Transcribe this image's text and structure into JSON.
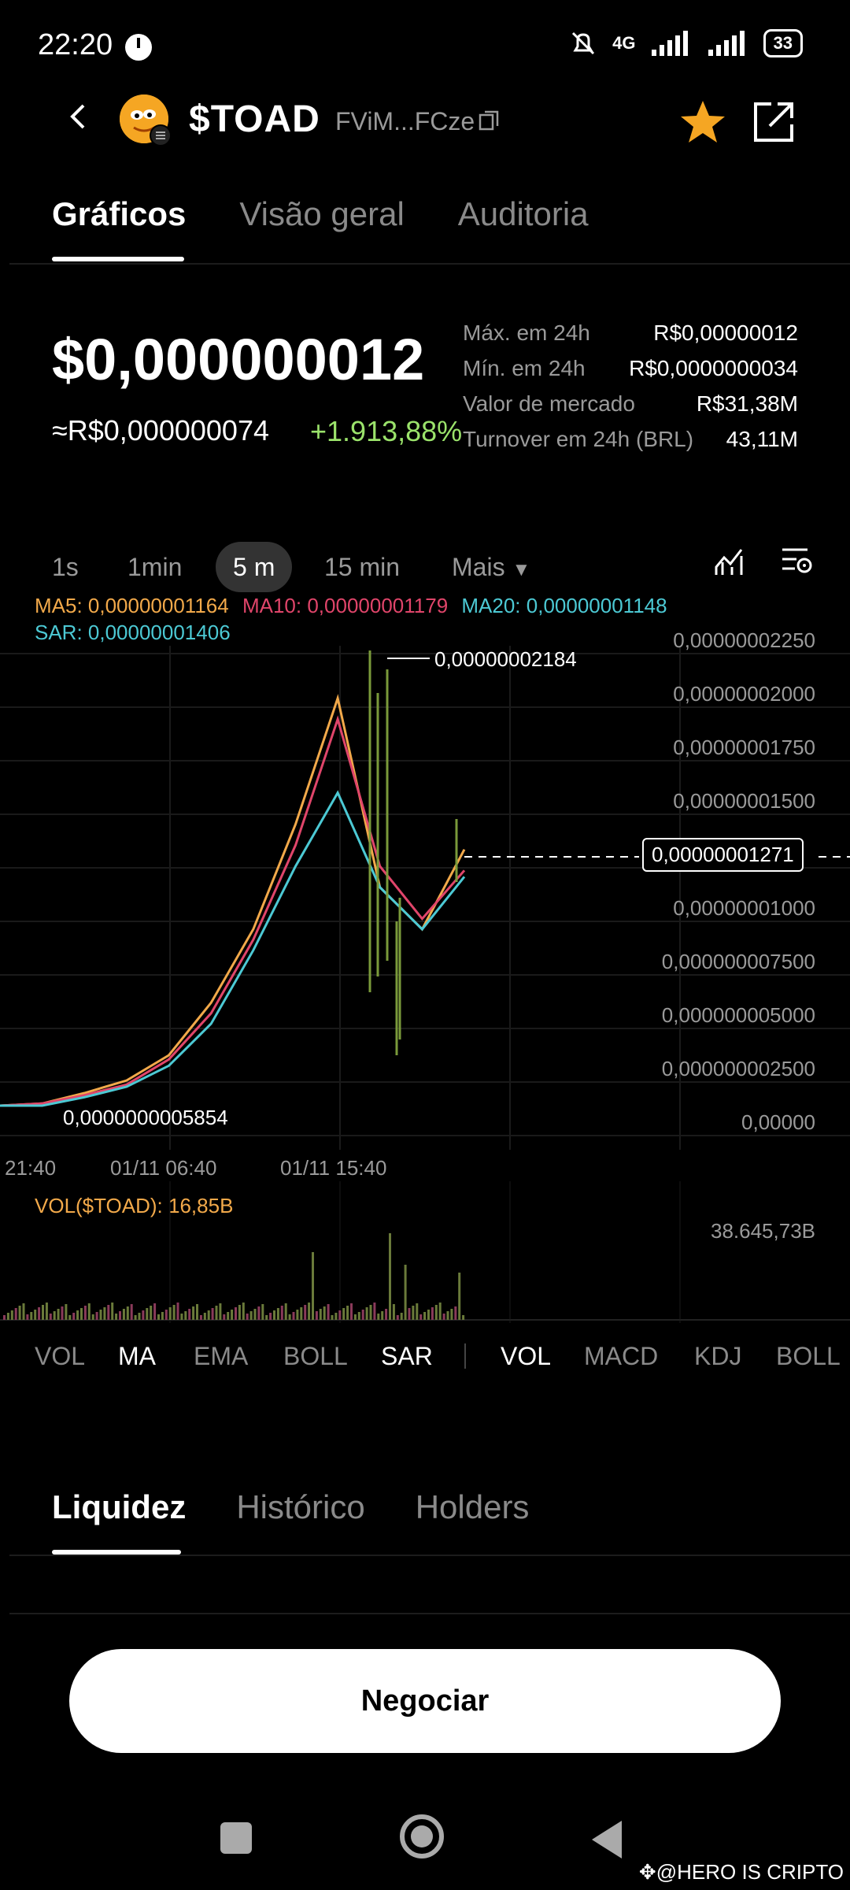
{
  "status": {
    "time": "22:20",
    "network": "4G",
    "battery": "33"
  },
  "header": {
    "token": "$TOAD",
    "address": "FViM...FCze"
  },
  "tabs": [
    "Gráficos",
    "Visão geral",
    "Auditoria"
  ],
  "price": {
    "usd": "$0,000000012",
    "brl": "≈R$0,000000074",
    "change": "+1.913,88%"
  },
  "stats": [
    {
      "label": "Máx. em 24h",
      "value": "R$0,00000012"
    },
    {
      "label": "Mín. em 24h",
      "value": "R$0,0000000034"
    },
    {
      "label": "Valor de mercado",
      "value": "R$31,38M"
    },
    {
      "label": "Turnover em 24h (BRL)",
      "value": "43,11M"
    }
  ],
  "timeframes": [
    "1s",
    "1min",
    "5 m",
    "15 min",
    "Mais"
  ],
  "indicators": {
    "ma5": "MA5: 0,00000001164",
    "ma10": "MA10: 0,00000001179",
    "ma20": "MA20: 0,00000001148",
    "sar": "SAR: 0,00000001406"
  },
  "chart": {
    "y_ticks": [
      "0,00000002250",
      "0,00000002000",
      "0,00000001750",
      "0,00000001500",
      "0,00000001000",
      "0,000000007500",
      "0,000000005000",
      "0,000000002500",
      "0,00000"
    ],
    "current": "0,00000001271",
    "high_label": "0,00000002184",
    "low_label": "0,0000000005854",
    "x_ticks": [
      "21:40",
      "01/11 06:40",
      "01/11 15:40"
    ]
  },
  "chart_data": {
    "type": "line",
    "ylim": [
      0,
      2.25e-08
    ],
    "series": [
      {
        "name": "MA5",
        "color": "#f2a94a",
        "values": [
          6e-10,
          7e-10,
          1.2e-09,
          1.8e-09,
          3e-09,
          5.5e-09,
          9e-09,
          1.4e-08,
          2e-08,
          1.1e-08,
          9e-09,
          1.28e-08
        ]
      },
      {
        "name": "MA10",
        "color": "#e0456a",
        "values": [
          6e-10,
          7e-10,
          1.1e-09,
          1.6e-09,
          2.8e-09,
          5e-09,
          8.5e-09,
          1.3e-08,
          1.9e-08,
          1.2e-08,
          9.5e-09,
          1.18e-08
        ]
      },
      {
        "name": "MA20",
        "color": "#4cc9d4",
        "values": [
          6e-10,
          6e-10,
          1e-09,
          1.5e-09,
          2.5e-09,
          4.5e-09,
          8e-09,
          1.2e-08,
          1.55e-08,
          1.1e-08,
          9e-09,
          1.15e-08
        ]
      }
    ]
  },
  "volume": {
    "label": "VOL($TOAD): 16,85B",
    "max": "38.645,73B"
  },
  "indicator_tabs_main": [
    "VOL",
    "MA",
    "EMA",
    "BOLL",
    "SAR"
  ],
  "indicator_tabs_sub": [
    "VOL",
    "MACD",
    "KDJ",
    "BOLL"
  ],
  "bottom_tabs": [
    "Liquidez",
    "Histórico",
    "Holders"
  ],
  "trade_button": "Negociar",
  "watermark": "@HERO IS CRIPTO"
}
